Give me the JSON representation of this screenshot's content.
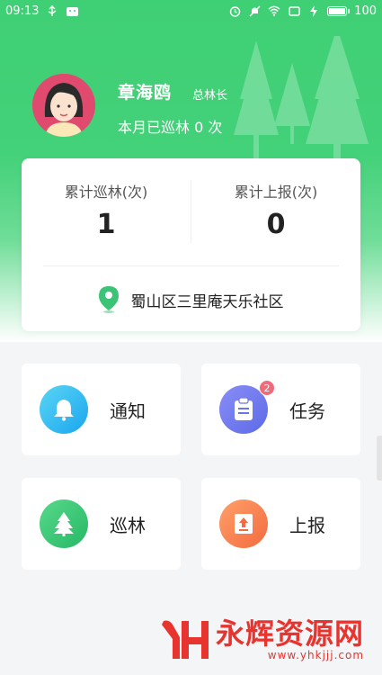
{
  "status_bar": {
    "time": "09:13",
    "battery": "100"
  },
  "profile": {
    "name": "章海鸥",
    "role": "总林长",
    "monthly_patrol": "本月已巡林 0 次"
  },
  "stats": {
    "total_patrol_label": "累计巡林(次)",
    "total_patrol_value": "1",
    "total_report_label": "累计上报(次)",
    "total_report_value": "0",
    "location": "蜀山区三里庵天乐社区"
  },
  "tiles": {
    "notice_label": "通知",
    "task_label": "任务",
    "task_badge": "2",
    "patrol_label": "巡林",
    "report_label": "上报"
  },
  "watermark": {
    "text": "永辉资源网",
    "url": "www.yhkjjj.com"
  },
  "colors": {
    "primary_green": "#43d179",
    "notice_blue": "#1aa6ee",
    "task_purple": "#5c6ae8",
    "patrol_green": "#26b866",
    "report_orange": "#f36b3f",
    "badge_red": "#ef6a7a"
  }
}
